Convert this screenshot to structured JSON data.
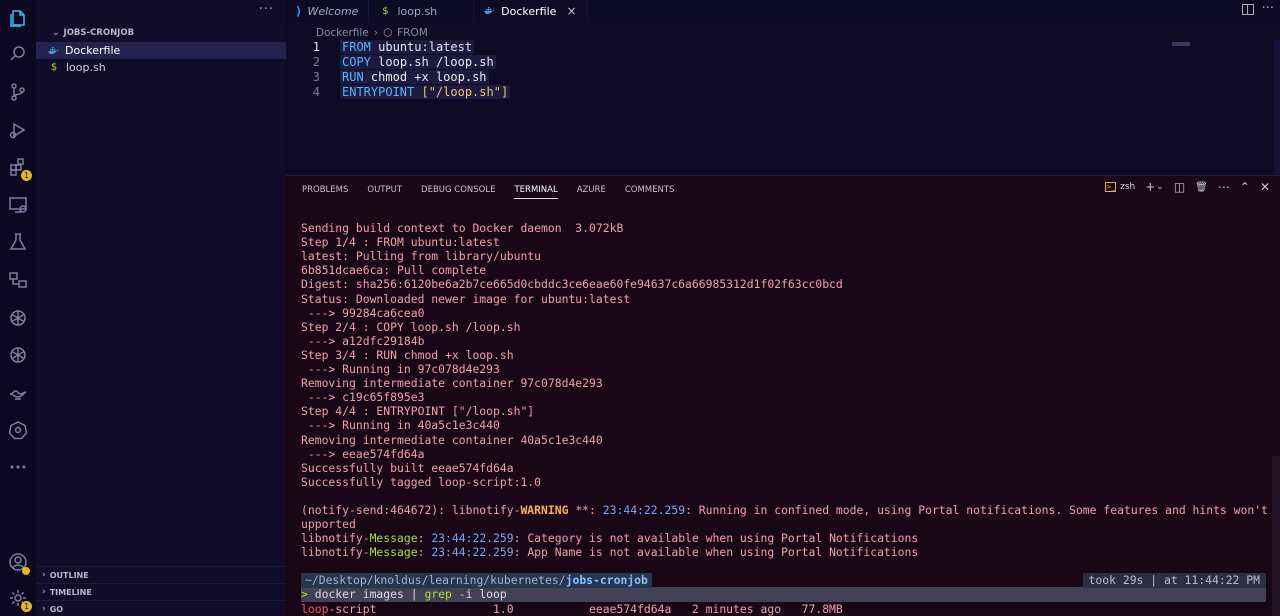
{
  "activity_bar": {
    "items": [
      {
        "name": "explorer-icon",
        "active": true
      },
      {
        "name": "search-icon"
      },
      {
        "name": "source-control-icon"
      },
      {
        "name": "run-debug-icon"
      },
      {
        "name": "extensions-icon",
        "badge": "1"
      },
      {
        "name": "remote-explorer-icon"
      },
      {
        "name": "testing-icon"
      },
      {
        "name": "containers-icon"
      },
      {
        "name": "openai-icon"
      },
      {
        "name": "openai-icon-2"
      },
      {
        "name": "genie-lamp-icon"
      },
      {
        "name": "kubernetes-icon"
      },
      {
        "name": "more-icon"
      },
      {
        "name": "accounts-icon"
      },
      {
        "name": "settings-gear-icon",
        "badge": "1"
      }
    ]
  },
  "sidebar": {
    "folder": "JOBS-CRONJOB",
    "files": [
      {
        "label": "Dockerfile",
        "icon": "docker-icon",
        "selected": true
      },
      {
        "label": "loop.sh",
        "icon": "shell-icon",
        "selected": false
      }
    ],
    "sections": [
      "OUTLINE",
      "TIMELINE",
      "GO"
    ]
  },
  "tabs": [
    {
      "label": "Welcome",
      "icon": "vscode-icon",
      "active": false
    },
    {
      "label": "loop.sh",
      "icon": "shell-icon",
      "active": false
    },
    {
      "label": "Dockerfile",
      "icon": "docker-icon",
      "active": true,
      "close": "×"
    }
  ],
  "breadcrumb": {
    "file": "Dockerfile",
    "separator": "›",
    "symbol": "FROM"
  },
  "editor": {
    "lines": [
      {
        "num": "1",
        "kw": "FROM",
        "rest": "ubuntu:latest"
      },
      {
        "num": "2",
        "kw": "COPY",
        "rest": "loop.sh /loop.sh"
      },
      {
        "num": "3",
        "kw": "RUN",
        "rest": "chmod +x loop.sh"
      },
      {
        "num": "4",
        "kw": "ENTRYPOINT",
        "rest": "[\"/loop.sh\"]"
      }
    ]
  },
  "panel": {
    "tabs": [
      "PROBLEMS",
      "OUTPUT",
      "DEBUG CONSOLE",
      "TERMINAL",
      "AZURE",
      "COMMENTS"
    ],
    "active_tab": "TERMINAL",
    "shell": "zsh",
    "actions": {
      "add": "+",
      "dropdown": "⌄",
      "split": "◫",
      "trash": "🗑",
      "more": "⋯",
      "maximize": "⌃",
      "close": "✕"
    }
  },
  "terminal": {
    "build_lines": [
      "Sending build context to Docker daemon  3.072kB",
      "Step 1/4 : FROM ubuntu:latest",
      "latest: Pulling from library/ubuntu",
      "6b851dcae6ca: Pull complete",
      "Digest: sha256:6120be6a2b7ce665d0cbddc3ce6eae60fe94637c6a66985312d1f02f63cc0bcd",
      "Status: Downloaded newer image for ubuntu:latest",
      " ---> 99284ca6cea0",
      "Step 2/4 : COPY loop.sh /loop.sh",
      " ---> a12dfc29184b",
      "Step 3/4 : RUN chmod +x loop.sh",
      " ---> Running in 97c078d4e293",
      "Removing intermediate container 97c078d4e293",
      " ---> c19c65f895e3",
      "Step 4/4 : ENTRYPOINT [\"/loop.sh\"]",
      " ---> Running in 40a5c1e3c440",
      "Removing intermediate container 40a5c1e3c440",
      " ---> eeae574fd64a",
      "Successfully built eeae574fd64a",
      "Successfully tagged loop-script:1.0"
    ],
    "notify": {
      "prefix": "(notify-send:464672): libnotify-",
      "warning": "WARNING",
      "sep": " **: ",
      "time": "23:44:22.259",
      "text1": ": Running in confined mode, using Portal notifications. Some features and hints won't be s",
      "text2": "upported"
    },
    "messages": [
      {
        "prefix": "libnotify-",
        "label": "Message",
        "sep": ": ",
        "time": "23:44:22.259",
        "text": ": Category is not available when using Portal Notifications"
      },
      {
        "prefix": "libnotify-",
        "label": "Message",
        "sep": ": ",
        "time": "23:44:22.259",
        "text": ": App Name is not available when using Portal Notifications"
      }
    ],
    "prompt": {
      "path_prefix": "~/Desktop/knoldus/learning/kubernetes/",
      "path_dir": "jobs-cronjob",
      "took": "took 29s | at 11:44:22 PM"
    },
    "command": {
      "gt": ">",
      "cmd": " docker images | ",
      "grep": "grep",
      "args": " -i loop"
    },
    "result": {
      "hl": "loop",
      "rest": "-script                 1.0           eeae574fd64a   2 minutes ago   77.8MB"
    }
  }
}
